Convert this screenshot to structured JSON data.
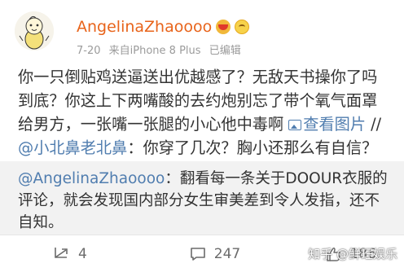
{
  "post": {
    "username": "AngelinaZhaoooo",
    "date": "7-20",
    "source": "来自iPhone 8 Plus",
    "edited": "已编辑",
    "text_parts": {
      "main": "你一只倒贴鸡送逼送出优越感了？无敌天书操你了吗到底？你这上下两嘴酸的去约炮别忘了带个氧气面罩给男方，一张嘴一张腿的小心他中毒啊",
      "view_pic": "查看图片",
      "sep": " //",
      "mention": "@小北鼻老北鼻",
      "tail": "：你穿了几次？胸小还那么有自信？"
    }
  },
  "quote": {
    "mention": "@AngelinaZhaoooo",
    "text": "：翻看每一条关于DOOUR衣服的评论，就会发现国内部分女生审美差到令人发指，还不自知。"
  },
  "actions": {
    "repost_count": "4",
    "comment_count": "247",
    "like_count": "186"
  },
  "watermark": "知乎 @鲜珏娱乐",
  "colors": {
    "username": "#e8641b",
    "link": "#507daf",
    "quote_bg": "#f2f2f2",
    "meta": "#9b9b9b"
  }
}
